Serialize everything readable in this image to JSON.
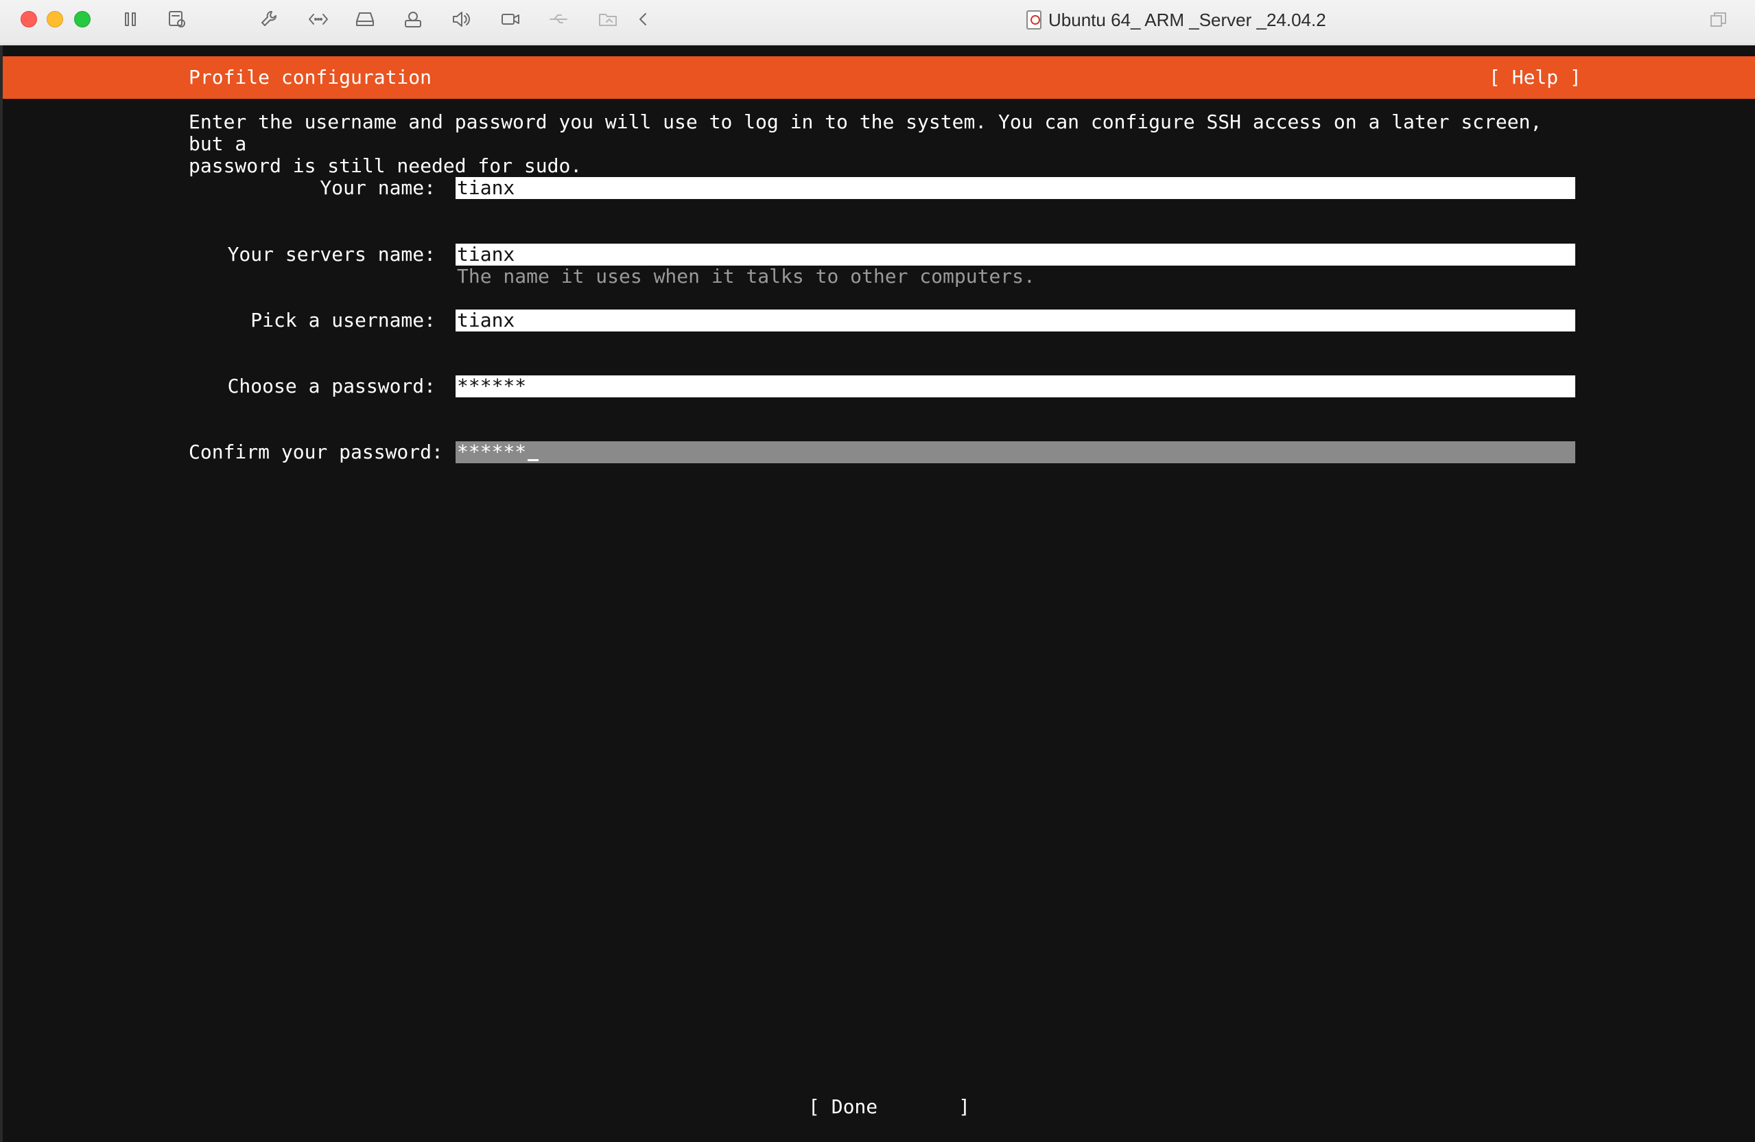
{
  "window": {
    "title": "Ubuntu 64_ ARM _Server _24.04.2",
    "toolbar_icons": [
      "pause-icon",
      "snapshot-icon",
      "settings-wrench-icon",
      "network-icon",
      "disk-icon",
      "printer-icon",
      "sound-icon",
      "camera-icon",
      "usb-icon",
      "shared-folder-icon",
      "chevron-left-icon"
    ]
  },
  "installer": {
    "header_title": "Profile configuration",
    "help_label": "[ Help ]",
    "intro": "Enter the username and password you will use to log in to the system. You can configure SSH access on a later screen, but a\npassword is still needed for sudo.",
    "fields": [
      {
        "label": "Your name:",
        "value": "tianx"
      },
      {
        "label": "Your servers name:",
        "value": "tianx",
        "hint": "The name it uses when it talks to other computers."
      },
      {
        "label": "Pick a username:",
        "value": "tianx"
      },
      {
        "label": "Choose a password:",
        "value": "******"
      },
      {
        "label": "Confirm your password:",
        "value": "******"
      }
    ],
    "done_label": "[ Done       ]"
  },
  "colors": {
    "ubuntu_orange": "#e95420",
    "console_bg": "#121212",
    "focused_field": "#8a8a8a"
  }
}
